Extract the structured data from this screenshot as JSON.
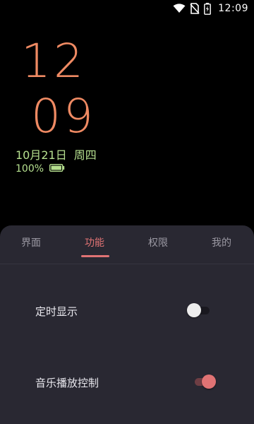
{
  "status_bar": {
    "time": "12:09",
    "icons": [
      "wifi-icon",
      "no-sim-icon",
      "battery-charging-icon"
    ]
  },
  "clock": {
    "hour": "12",
    "minute": "09",
    "date": "10月21日",
    "weekday": "周四",
    "battery_percent": "100%",
    "colors": {
      "time": "#ef8a63",
      "date": "#b6e08f"
    }
  },
  "panel": {
    "tabs": [
      {
        "label": "界面",
        "active": false
      },
      {
        "label": "功能",
        "active": true
      },
      {
        "label": "权限",
        "active": false
      },
      {
        "label": "我的",
        "active": false
      }
    ],
    "settings": [
      {
        "label": "定时显示",
        "enabled": false
      },
      {
        "label": "音乐播放控制",
        "enabled": true
      }
    ],
    "colors": {
      "background": "#292832",
      "accent": "#e07374"
    }
  }
}
